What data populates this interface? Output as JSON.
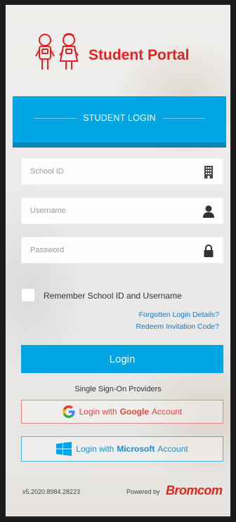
{
  "brand": {
    "title": "Student Portal",
    "color": "#e52222",
    "logo_icon": "two-students-logo"
  },
  "banner": {
    "title": "STUDENT LOGIN",
    "color": "#00a5e1"
  },
  "fields": {
    "school_id": {
      "placeholder": "School ID",
      "value": "",
      "icon": "building-icon"
    },
    "username": {
      "placeholder": "Username",
      "value": "",
      "icon": "user-icon"
    },
    "password": {
      "placeholder": "Password",
      "value": "",
      "icon": "lock-icon"
    }
  },
  "remember": {
    "label": "Remember School ID and Username",
    "checked": false
  },
  "links": {
    "forgotten": "Forgotten Login Details?",
    "redeem": "Redeem Invitation Code?"
  },
  "login_button": {
    "label": "Login"
  },
  "sso": {
    "title": "Single Sign-On Providers",
    "google": {
      "prefix": "Login with",
      "provider": "Google",
      "suffix": "Account",
      "icon": "google-icon"
    },
    "microsoft": {
      "prefix": "Login with",
      "provider": "Microsoft",
      "suffix": "Account",
      "icon": "windows-icon"
    }
  },
  "footer": {
    "version": "v5.2020.8984.28223",
    "powered_by": "Powered by",
    "company": "Bromcom"
  }
}
